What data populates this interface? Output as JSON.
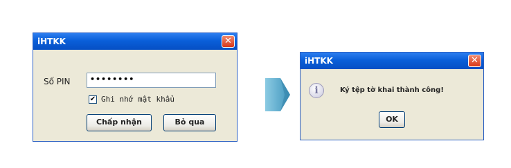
{
  "login_dialog": {
    "title": "iHTKK",
    "close_glyph": "✕",
    "pin_label": "Số PIN",
    "pin_value": "••••••••",
    "remember_checked": true,
    "check_glyph": "✔",
    "remember_label": "Ghi nhớ mật khẩu",
    "ok_label": "Chấp nhận",
    "cancel_label": "Bỏ qua"
  },
  "message_dialog": {
    "title": "iHTKK",
    "close_glyph": "✕",
    "icon_glyph": "i",
    "message": "Ký tệp tờ khai thành công!",
    "ok_label": "OK"
  },
  "icons": {
    "arrow": "arrow-right-icon",
    "info": "info-icon",
    "close": "close-icon",
    "check": "check-icon"
  },
  "colors": {
    "titlebar": "#0a5fd9",
    "dialog_bg": "#ece9d8",
    "close_button": "#d9391b",
    "arrow": "#4ea3c9"
  }
}
